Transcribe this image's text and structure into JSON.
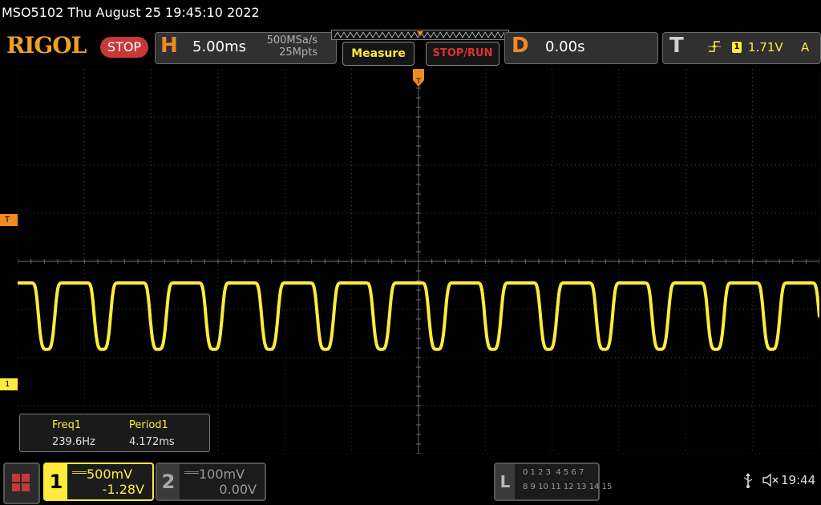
{
  "header": {
    "title": "MSO5102  Thu August 25 19:45:10 2022",
    "logo": "RIGOL",
    "status": "STOP"
  },
  "horizontal": {
    "letter": "H",
    "timebase": "5.00ms",
    "sample_rate": "500MSa/s",
    "memory_depth": "25Mpts"
  },
  "buttons": {
    "measure": "Measure",
    "stop_run": "STOP/RUN"
  },
  "delay": {
    "letter": "D",
    "value": "0.00s"
  },
  "trigger": {
    "letter": "T",
    "edge_icon": "rising-edge-icon",
    "source": "1",
    "level": "1.71V",
    "mode": "A",
    "marker_label": "T"
  },
  "waveform": {
    "channel_marker": "1",
    "color": "#ffeb3b",
    "frequency_hz": 239.6,
    "high_level_div": 2.0,
    "low_level_div": 0.7
  },
  "measurements": [
    {
      "name": "Freq1",
      "value": "239.6Hz"
    },
    {
      "name": "Period1",
      "value": "4.172ms"
    }
  ],
  "channels": [
    {
      "number": "1",
      "scale": "500mV",
      "offset": "-1.28V",
      "active": true
    },
    {
      "number": "2",
      "scale": "100mV",
      "offset": "0.00V",
      "active": false
    }
  ],
  "logic": {
    "letter": "L",
    "row1": "0 1 2 3  4 5 6 7",
    "row2": "8 9 10 11 12 13 14 15"
  },
  "status_bar": {
    "usb_icon": "usb-icon",
    "speaker_icon": "speaker-muted-icon",
    "time": "19:44"
  }
}
